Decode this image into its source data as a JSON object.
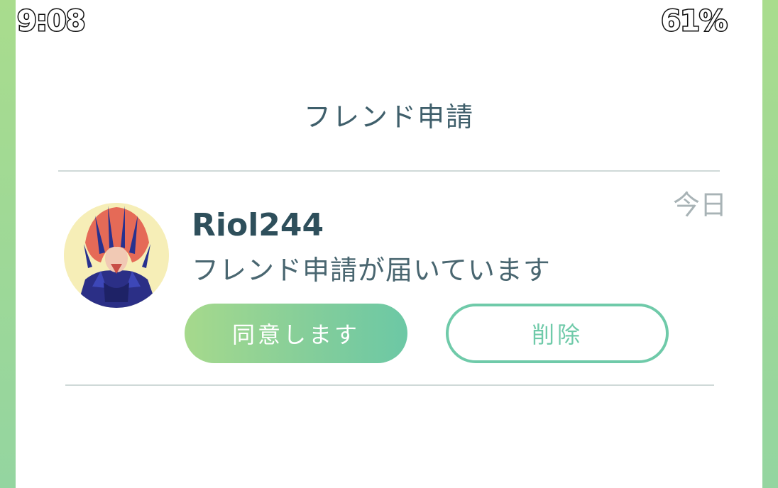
{
  "status_bar": {
    "time": "9:08",
    "battery": "61%"
  },
  "header": {
    "title": "フレンド申請"
  },
  "request": {
    "timestamp": "今日",
    "username": "Riol244",
    "message": "フレンド申請が届いています",
    "accept_label": "同意します",
    "delete_label": "削除"
  },
  "colors": {
    "accent_green": "#6fcaa9",
    "background_green": "#a9dc8d",
    "text_dark": "#2e4f5b",
    "avatar_bg": "#f6eeb7"
  },
  "icons": {
    "avatar": "trainer-avatar-icon"
  }
}
